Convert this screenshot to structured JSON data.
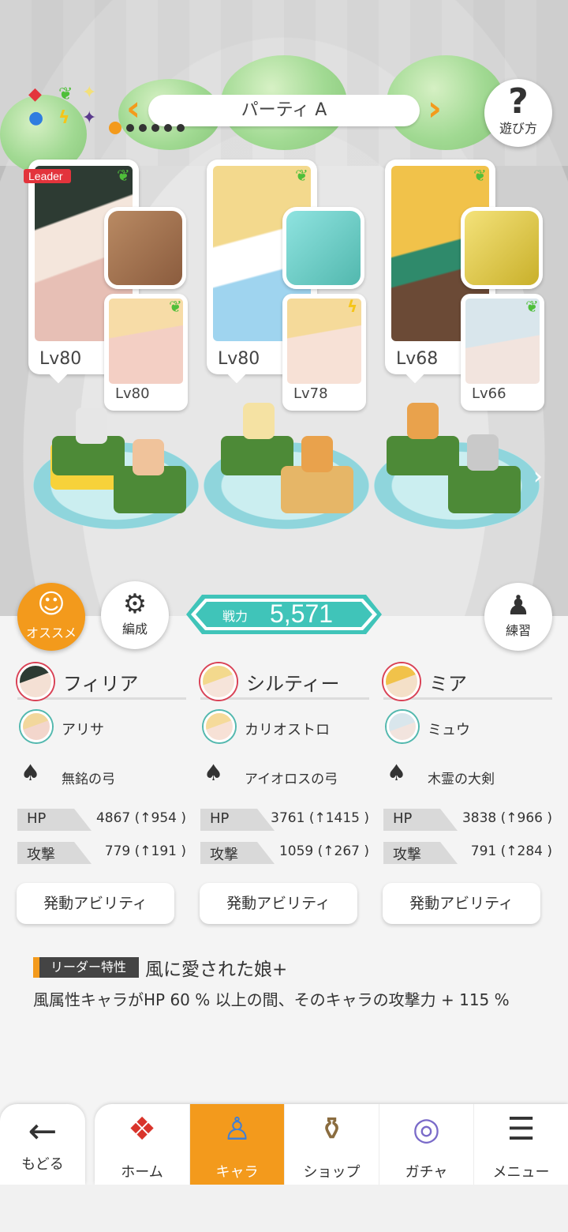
{
  "party": {
    "title": "パーティ A",
    "page_count": 6,
    "active_page": 1
  },
  "howto": {
    "label": "遊び方",
    "icon": "question-icon"
  },
  "element_icons": [
    "fire-diamond",
    "wind-leaf",
    "light-sparkle",
    "water-circle",
    "thunder-bolt",
    "dark-star"
  ],
  "colors": {
    "accent": "#f39a1c",
    "teal": "#40c4b9",
    "leader": "#e3343c",
    "wind": "#4fbf3a",
    "thunder": "#f5c518"
  },
  "slots": [
    {
      "leader_tag": "Leader",
      "main": {
        "level": "Lv80",
        "element": "wind",
        "name": "フィリア"
      },
      "sub": {
        "level": "Lv80",
        "element": "wind",
        "name": "アリサ"
      },
      "weapon": {
        "name": "無銘の弓",
        "icon": "bow-icon"
      },
      "hp": {
        "label": "HP",
        "value": "4867 (↑954 )"
      },
      "atk": {
        "label": "攻撃",
        "value": "779 (↑191 )"
      },
      "ability": "発動アビリティ"
    },
    {
      "main": {
        "level": "Lv80",
        "element": "wind",
        "name": "シルティー"
      },
      "sub": {
        "level": "Lv78",
        "element": "thunder",
        "name": "カリオストロ"
      },
      "weapon": {
        "name": "アイオロスの弓",
        "icon": "bow-icon"
      },
      "hp": {
        "label": "HP",
        "value": "3761 (↑1415 )"
      },
      "atk": {
        "label": "攻撃",
        "value": "1059 (↑267 )"
      },
      "ability": "発動アビリティ"
    },
    {
      "main": {
        "level": "Lv68",
        "element": "wind",
        "name": "ミア"
      },
      "sub": {
        "level": "Lv66",
        "element": "wind",
        "name": "ミュウ"
      },
      "weapon": {
        "name": "木霊の大剣",
        "icon": "greatsword-icon"
      },
      "hp": {
        "label": "HP",
        "value": "3838 (↑966 )"
      },
      "atk": {
        "label": "攻撃",
        "value": "791 (↑284 )"
      },
      "ability": "発動アビリティ"
    }
  ],
  "actions": {
    "recommend": "オススメ",
    "formation": "編成",
    "practice": "練習"
  },
  "power": {
    "label": "戦力",
    "value": "5,571"
  },
  "leader_skill": {
    "tag": "リーダー特性",
    "name": "風に愛された娘+",
    "description": "風属性キャラがHP 60 % 以上の間、そのキャラの攻撃力 + 115 %"
  },
  "nav": {
    "back": "もどる",
    "items": [
      {
        "label": "ホーム",
        "icon": "home-icon"
      },
      {
        "label": "キャラ",
        "icon": "character-icon",
        "active": true
      },
      {
        "label": "ショップ",
        "icon": "shop-icon"
      },
      {
        "label": "ガチャ",
        "icon": "gacha-icon"
      },
      {
        "label": "メニュー",
        "icon": "menu-icon"
      }
    ]
  }
}
